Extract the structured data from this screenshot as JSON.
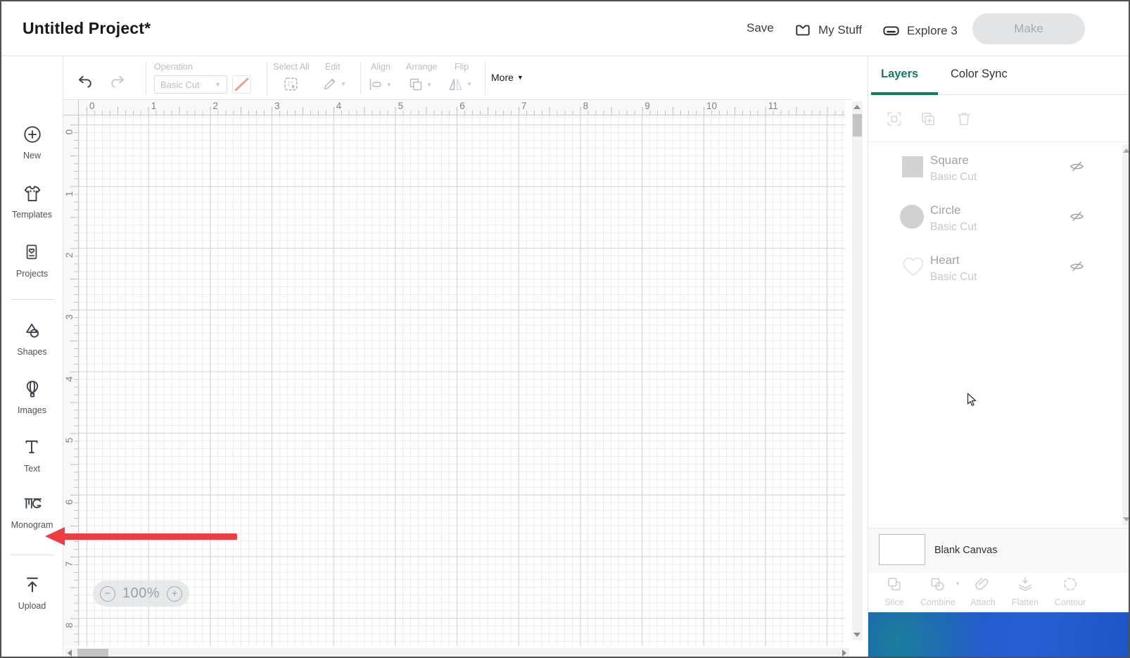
{
  "header": {
    "title": "Untitled Project*",
    "save_label": "Save",
    "my_stuff_label": "My Stuff",
    "machine_label": "Explore 3",
    "make_label": "Make"
  },
  "sidebar": {
    "items": [
      {
        "label": "New",
        "icon": "plus-circle-icon"
      },
      {
        "label": "Templates",
        "icon": "tshirt-icon"
      },
      {
        "label": "Projects",
        "icon": "project-card-icon"
      },
      {
        "label": "Shapes",
        "icon": "shapes-icon"
      },
      {
        "label": "Images",
        "icon": "balloon-icon"
      },
      {
        "label": "Text",
        "icon": "text-icon"
      },
      {
        "label": "Monogram",
        "icon": "monogram-icon"
      },
      {
        "label": "Upload",
        "icon": "upload-icon"
      }
    ]
  },
  "toolbar": {
    "operation_label": "Operation",
    "operation_value": "Basic Cut",
    "select_all_label": "Select All",
    "edit_label": "Edit",
    "align_label": "Align",
    "arrange_label": "Arrange",
    "flip_label": "Flip",
    "more_label": "More"
  },
  "canvas": {
    "zoom_level": "100%",
    "h_ruler": [
      "0",
      "1",
      "2",
      "3",
      "4",
      "5",
      "6",
      "7",
      "8",
      "9",
      "10",
      "11"
    ],
    "v_ruler": [
      "0",
      "1",
      "2",
      "3",
      "4",
      "5",
      "6",
      "7",
      "8"
    ]
  },
  "panel": {
    "tabs": {
      "layers": "Layers",
      "color_sync": "Color Sync"
    },
    "layer_tools": [
      "group-icon",
      "duplicate-icon",
      "trash-icon"
    ],
    "layers": [
      {
        "name": "Square",
        "operation": "Basic Cut",
        "shape": "square",
        "visibility": "hidden"
      },
      {
        "name": "Circle",
        "operation": "Basic Cut",
        "shape": "circle",
        "visibility": "hidden"
      },
      {
        "name": "Heart",
        "operation": "Basic Cut",
        "shape": "heart",
        "visibility": "hidden"
      }
    ],
    "canvas_row": {
      "label": "Blank Canvas"
    },
    "actions": [
      {
        "label": "Slice",
        "icon": "slice-icon"
      },
      {
        "label": "Combine",
        "icon": "combine-icon",
        "has_caret": true
      },
      {
        "label": "Attach",
        "icon": "attach-icon"
      },
      {
        "label": "Flatten",
        "icon": "flatten-icon"
      },
      {
        "label": "Contour",
        "icon": "contour-icon"
      }
    ]
  },
  "colors": {
    "accent_green": "#0c7d5f",
    "annotation_arrow_red": "#ee3d41",
    "banner_blue": "#2158c8",
    "operation_swatch_salmon": "#f0a28e",
    "disabled_gray": "#b9bdc3"
  }
}
